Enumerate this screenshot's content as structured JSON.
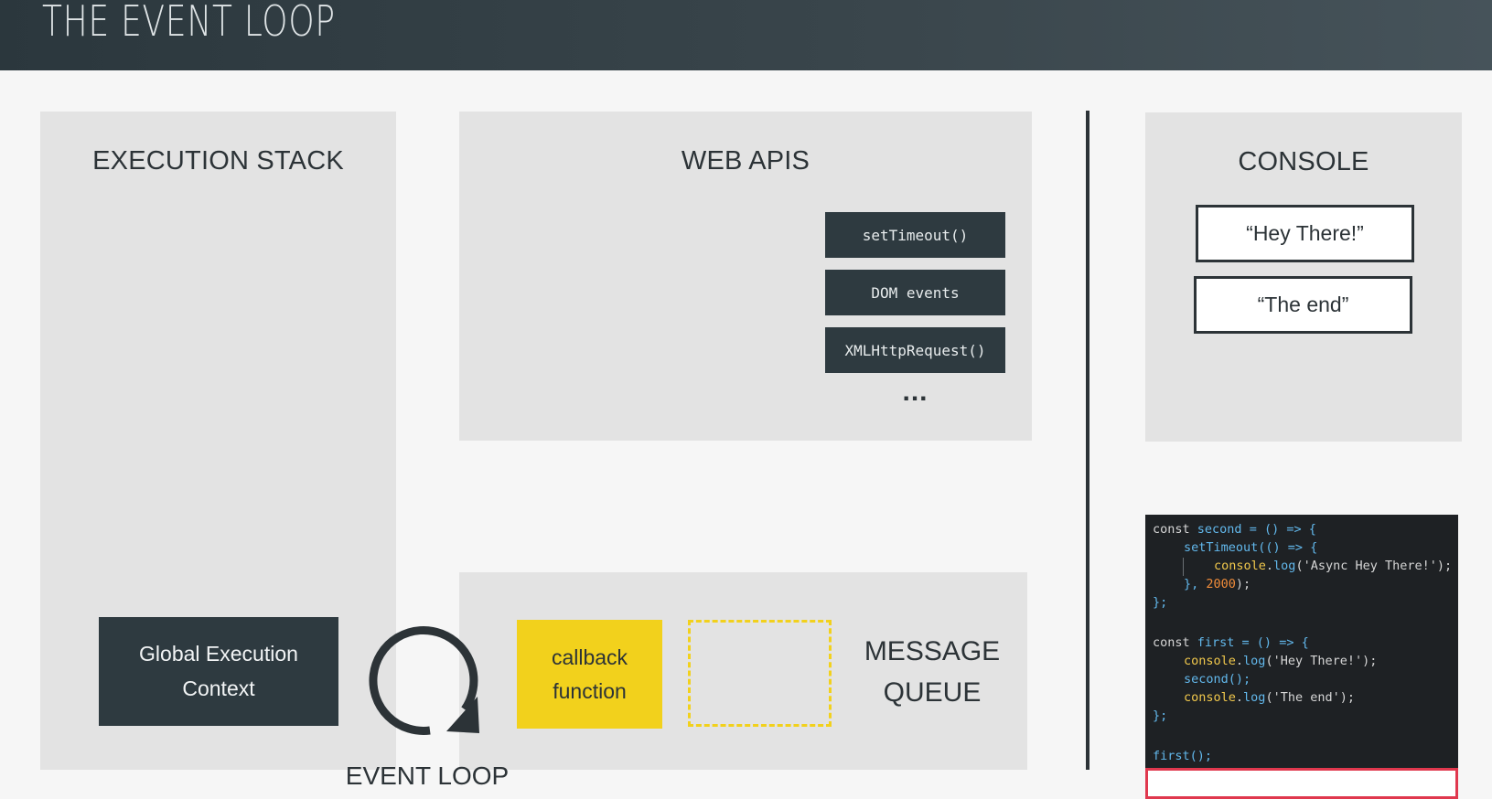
{
  "header": {
    "title": "THE EVENT LOOP"
  },
  "execution_stack": {
    "title": "EXECUTION STACK",
    "context_line1": "Global Execution",
    "context_line2": "Context"
  },
  "web_apis": {
    "title": "WEB APIS",
    "items": [
      "setTimeout()",
      "DOM events",
      "XMLHttpRequest()"
    ],
    "ellipsis": "..."
  },
  "console": {
    "title": "CONSOLE",
    "outputs": [
      "“Hey There!”",
      "“The end”"
    ]
  },
  "message_queue": {
    "title_line1": "MESSAGE",
    "title_line2": "QUEUE",
    "callback_line1": "callback",
    "callback_line2": "function"
  },
  "event_loop": {
    "label": "EVENT LOOP"
  },
  "code": {
    "l1_kw": "const ",
    "l1_id": "second",
    "l1_rest": " = () => {",
    "l2_fn": "setTimeout",
    "l2_rest": "(() => {",
    "l3_obj": "console",
    "l3_dot": ".",
    "l3_fn": "log",
    "l3_rest": "('Async Hey There!');",
    "l4_a": "}, ",
    "l4_num": "2000",
    "l4_b": ");",
    "l5": "};",
    "l7_kw": "const ",
    "l7_id": "first",
    "l7_rest": " = () => {",
    "l8_obj": "console",
    "l8_dot": ".",
    "l8_fn": "log",
    "l8_rest": "('Hey There!');",
    "l9": "second();",
    "l10_obj": "console",
    "l10_dot": ".",
    "l10_fn": "log",
    "l10_rest": "('The end');",
    "l11": "};",
    "l13": "first();"
  },
  "colors": {
    "header_bg": "#2e3a40",
    "panel_bg": "#e3e3e3",
    "dark_box": "#2e3a40",
    "callback_yellow": "#f2d11c",
    "highlight_red": "#e0384e",
    "code_bg": "#1e2124"
  }
}
